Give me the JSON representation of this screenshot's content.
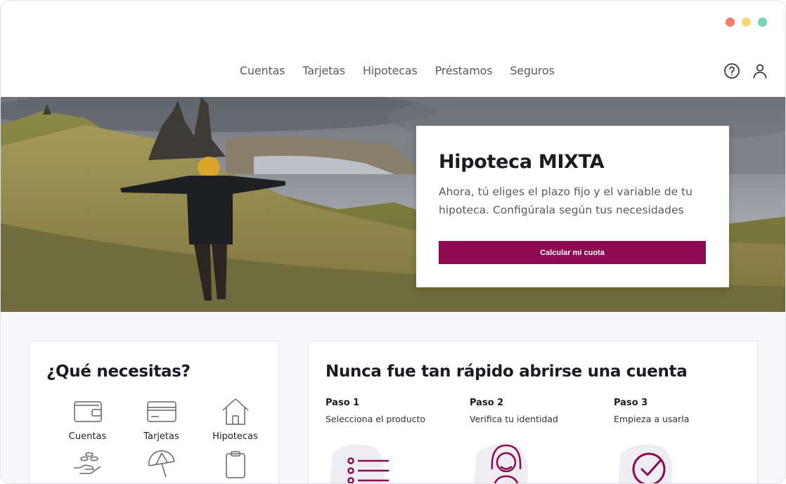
{
  "window": {
    "dots": [
      "#f47a6b",
      "#f6d87a",
      "#78d3b0"
    ]
  },
  "nav": {
    "items": [
      "Cuentas",
      "Tarjetas",
      "Hipotecas",
      "Préstamos",
      "Seguros"
    ],
    "help_icon": "question-circle-icon",
    "user_icon": "user-icon"
  },
  "hero": {
    "title": "Hipoteca MIXTA",
    "description": "Ahora, tú eliges el plazo fijo y el variable de tu hipoteca. Configúrala según tus necesidades",
    "button_label": "Calcular mi cuota",
    "accent": "#8c0a52"
  },
  "needs": {
    "title": "¿Qué necesitas?",
    "items": [
      {
        "label": "Cuentas",
        "icon": "wallet-icon"
      },
      {
        "label": "Tarjetas",
        "icon": "credit-card-icon"
      },
      {
        "label": "Hipotecas",
        "icon": "house-icon"
      },
      {
        "label": "",
        "icon": "hand-coins-icon"
      },
      {
        "label": "",
        "icon": "umbrella-icon"
      },
      {
        "label": "",
        "icon": "clipboard-icon"
      }
    ]
  },
  "steps": {
    "title": "Nunca fue tan rápido abrirse una cuenta",
    "items": [
      {
        "title": "Paso 1",
        "desc": "Selecciona el producto",
        "icon": "list-icon"
      },
      {
        "title": "Paso 2",
        "desc": "Verifica tu identidad",
        "icon": "person-icon"
      },
      {
        "title": "Paso 3",
        "desc": "Empieza a usarla",
        "icon": "check-circle-icon"
      }
    ]
  }
}
